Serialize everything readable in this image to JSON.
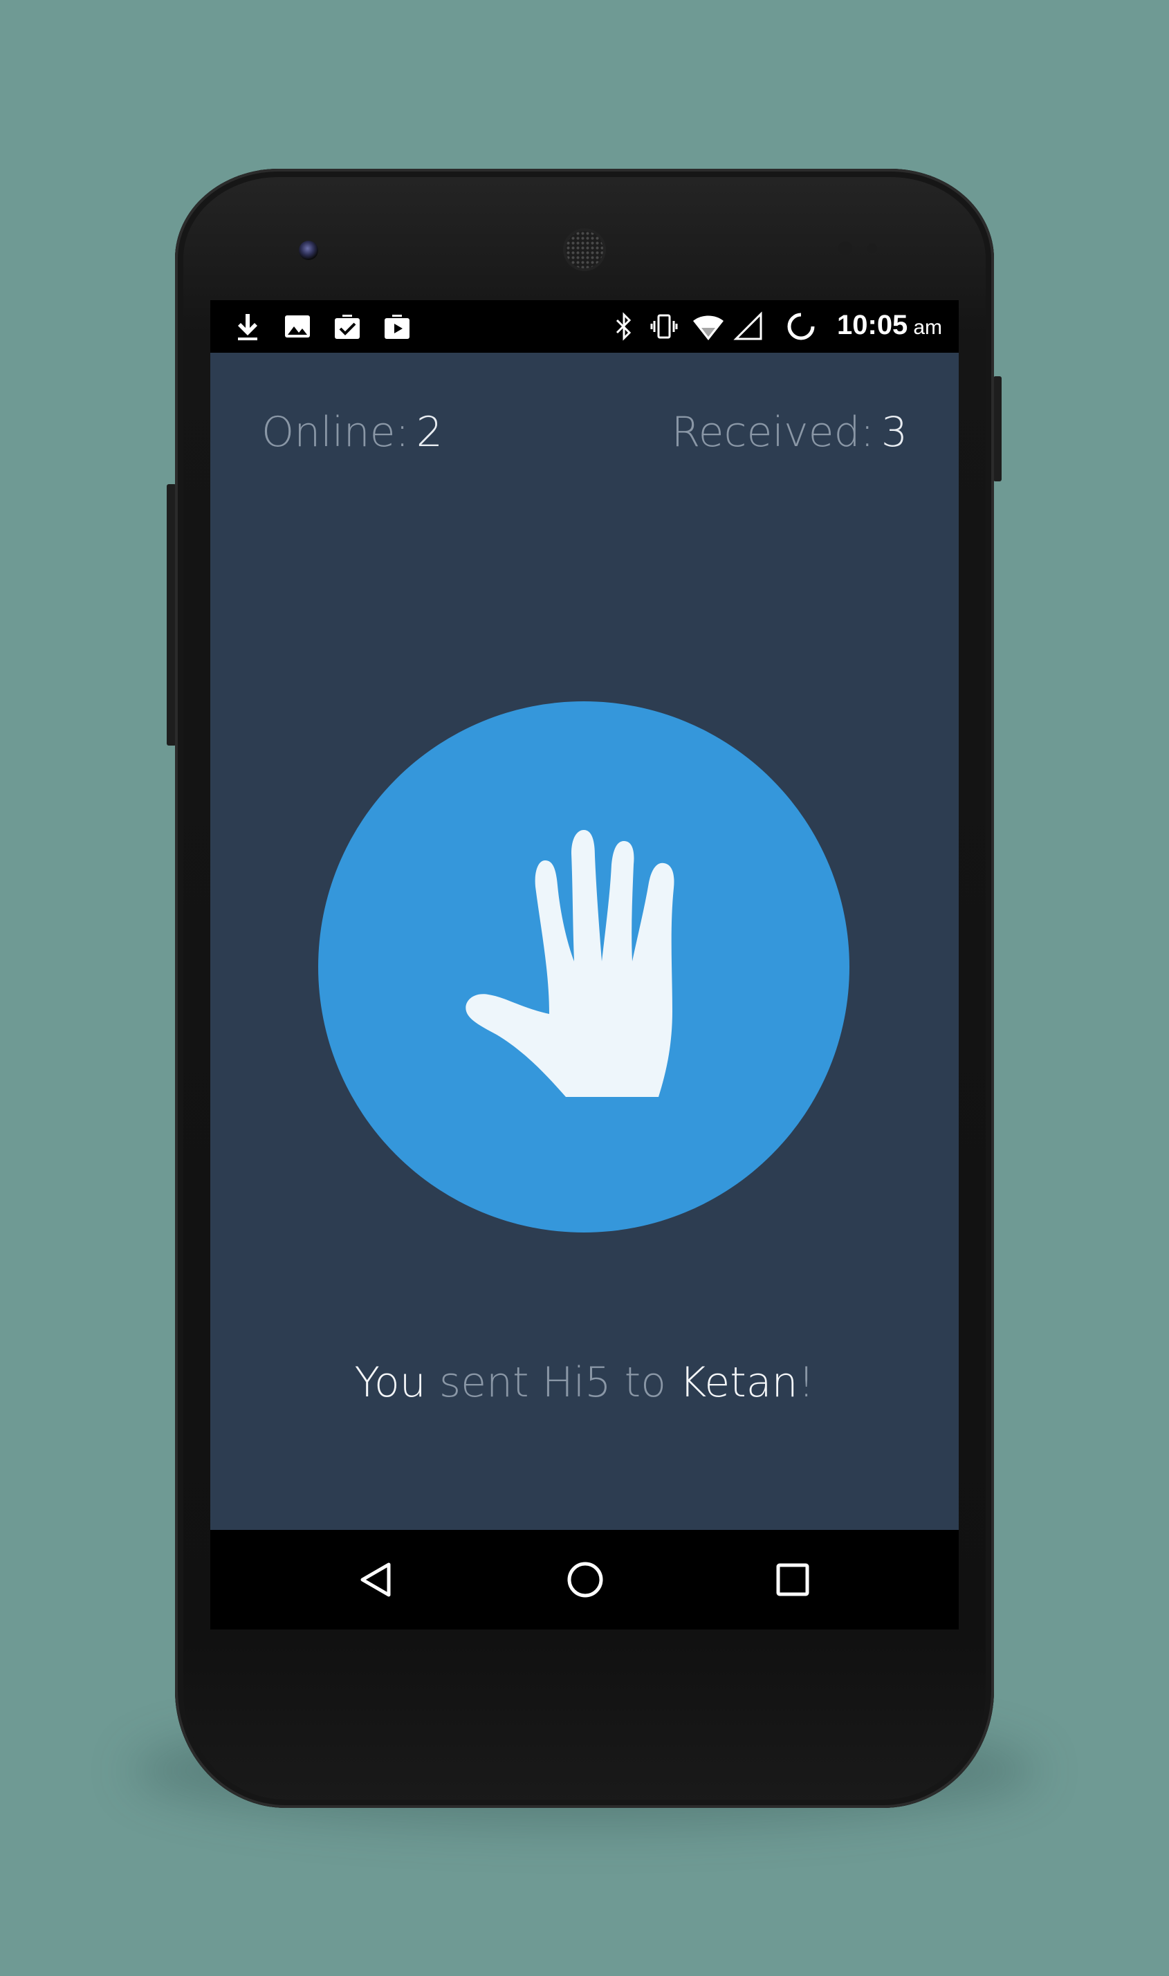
{
  "status_bar": {
    "time": "10:05",
    "ampm": "am",
    "notification_icons": [
      "download-icon",
      "image-icon",
      "clipboard-check-icon",
      "briefcase-play-icon"
    ],
    "system_icons": [
      "bluetooth-icon",
      "vibrate-icon",
      "wifi-icon",
      "cellular-signal-icon",
      "loading-spinner-icon"
    ]
  },
  "stats": {
    "online_label": "Online:",
    "online_value": "2",
    "received_label": "Received:",
    "received_value": "3"
  },
  "hi5": {
    "icon": "hand-icon",
    "button_color": "#3597db",
    "hand_color": "#eef6fb"
  },
  "message": {
    "part1": "You",
    "part2": " sent Hi5 to ",
    "part3": "Ketan",
    "part4": "!"
  },
  "nav": {
    "back_icon": "back-triangle-icon",
    "home_icon": "home-circle-icon",
    "recents_icon": "recents-square-icon"
  },
  "colors": {
    "background": "#6f9a94",
    "app_background": "#2d3d51",
    "accent": "#3597db",
    "muted_text": "#8a97a6",
    "bright_text": "#f4f6f8"
  }
}
